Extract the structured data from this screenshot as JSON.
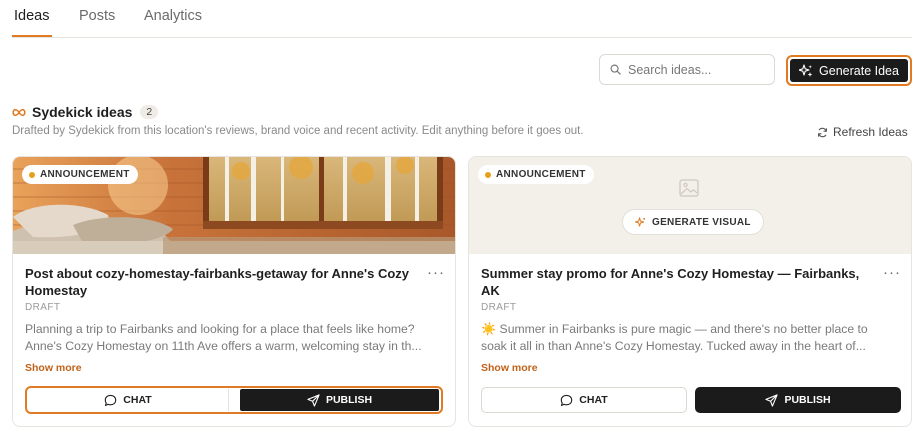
{
  "tabs": [
    {
      "label": "Ideas"
    },
    {
      "label": "Posts"
    },
    {
      "label": "Analytics"
    }
  ],
  "toolbar": {
    "search_placeholder": "Search ideas...",
    "generate_label": "Generate Idea"
  },
  "section": {
    "title": "Sydekick ideas",
    "count": "2",
    "subtitle": "Drafted by Sydekick from this location's reviews, brand voice and recent activity. Edit anything before it goes out.",
    "refresh_label": "Refresh Ideas"
  },
  "cards": [
    {
      "tag": "ANNOUNCEMENT",
      "title": "Post about cozy-homestay-fairbanks-getaway for Anne's Cozy Homestay",
      "status": "DRAFT",
      "body_line1": "Planning a trip to Fairbanks and looking for a place that feels like home?",
      "body_line2": "Anne's Cozy Homestay on 11th Ave offers a warm, welcoming stay in th...",
      "show_more": "Show more",
      "chat_label": "CHAT",
      "publish_label": "PUBLISH"
    },
    {
      "tag": "ANNOUNCEMENT",
      "generate_visual_label": "GENERATE VISUAL",
      "title": "Summer stay promo for Anne's Cozy Homestay — Fairbanks, AK",
      "status": "DRAFT",
      "body_line1": "☀️ Summer in Fairbanks is pure magic — and there's no better place to",
      "body_line2": "soak it all in than Anne's Cozy Homestay. Tucked away in the heart of...",
      "show_more": "Show more",
      "chat_label": "CHAT",
      "publish_label": "PUBLISH"
    }
  ],
  "colors": {
    "accent": "#e07b23",
    "dark_button": "#1b1b1b",
    "status_dot": "#e3a21a",
    "link": "#c0621a"
  },
  "icons": [
    "search-icon",
    "sparkle-icon",
    "infinity-icon",
    "refresh-icon",
    "image-icon",
    "chat-icon",
    "send-icon",
    "more-icon"
  ]
}
